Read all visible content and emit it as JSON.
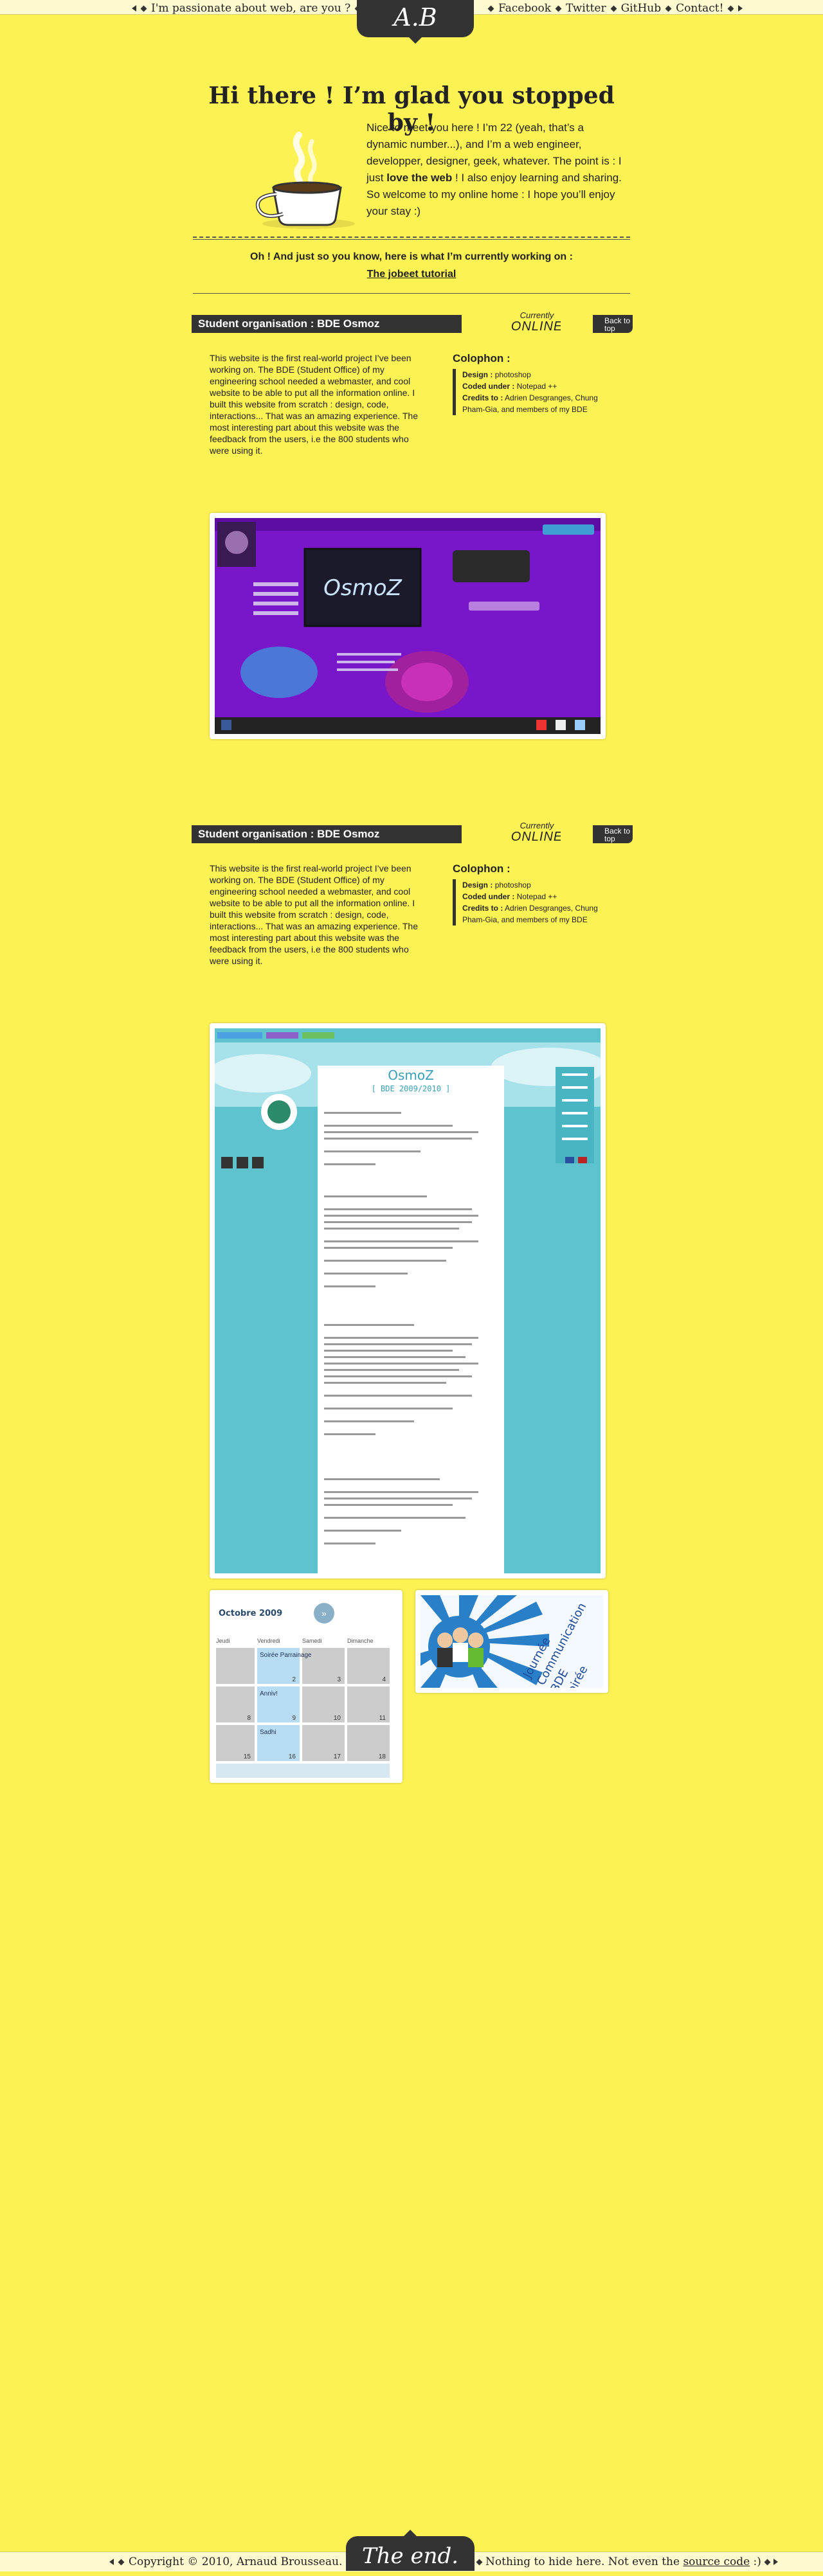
{
  "nav": {
    "tagline": "I'm passionate about web, are you ?",
    "logo": "A.B",
    "links": [
      "Facebook",
      "Twitter",
      "GitHub",
      "Contact!"
    ]
  },
  "hero": {
    "title": "Hi there ! I’m glad you stopped by !",
    "intro_1": "Nice to meet you here ! I’m 22 (yeah, that’s a dynamic number...), and I’m a  web engineer, developper, designer, geek, whatever. The point is : I just ",
    "intro_strong": "love the web",
    "intro_2": " ! I also enjoy learning and sharing. So welcome to my online home : I hope you’ll enjoy your stay :)"
  },
  "current": {
    "text": "Oh ! And just so you know, here is what I’m currently working on :",
    "link": "The jobeet tutorial"
  },
  "projects": [
    {
      "title": "Student organisation : BDE Osmoz",
      "status_small": "Currently",
      "status_big": "ONLINE",
      "back": "Back to top",
      "description": "This website is the first real-world project I’ve been working on. The BDE (Student Office) of my engineering school needed a webmaster, and cool website to be able to put all the information online. I built this website from scratch : design, code, interactions... That was an amazing experience. The most interesting part about this website was the feedback from the users, i.e the 800 students who were using it.",
      "colophon_title": "Colophon :",
      "design_label": "Design :",
      "design": "photoshop",
      "coded_label": "Coded under :",
      "coded": "Notepad ++",
      "credits_label": "Credits to :",
      "credits": "Adrien Desgranges, Chung Pham-Gia, and members of my BDE"
    },
    {
      "title": "Student organisation : BDE Osmoz",
      "status_small": "Currently",
      "status_big": "ONLINE",
      "back": "Back to top",
      "description": "This website is the first real-world project I’ve been working on. The BDE (Student Office) of my engineering school needed a webmaster, and cool website to be able to put all the information online. I built this website from scratch : design, code, interactions... That was an amazing experience. The most interesting part about this website was the feedback from the users, i.e the 800 students who were using it.",
      "colophon_title": "Colophon :",
      "design_label": "Design :",
      "design": "photoshop",
      "coded_label": "Coded under :",
      "coded": "Notepad ++",
      "credits_label": "Credits to :",
      "credits": "Adrien Desgranges, Chung Pham-Gia, and members of my BDE"
    }
  ],
  "screens": {
    "osmoz_logo": "OsmoZ",
    "bde_sub": "[ BDE 2009/2010 ]",
    "calendar_title": "Octobre 2009",
    "calendar_days": [
      "Jeudi",
      "Vendredi",
      "Samedi",
      "Dimanche"
    ],
    "calendar_events": [
      "Soirée Parrainage",
      "Anniv!",
      "Sadhi"
    ],
    "calendar_nums": [
      "2",
      "3",
      "4",
      "8",
      "9",
      "10",
      "11",
      "15",
      "16",
      "17",
      "18"
    ],
    "poster_words": [
      "Journée",
      "Communication",
      "BDE",
      "Soirée"
    ]
  },
  "footer": {
    "copyright": "Copyright © 2010, Arnaud Brousseau.",
    "end": "The end.",
    "hide_text": "Nothing to hide here. Not even the ",
    "source_link": "source code",
    "smile": " :)"
  },
  "colors": {
    "background": "#fdf254",
    "dark": "#333333",
    "purple": "#7a16c9",
    "teal": "#5ec3cf"
  }
}
